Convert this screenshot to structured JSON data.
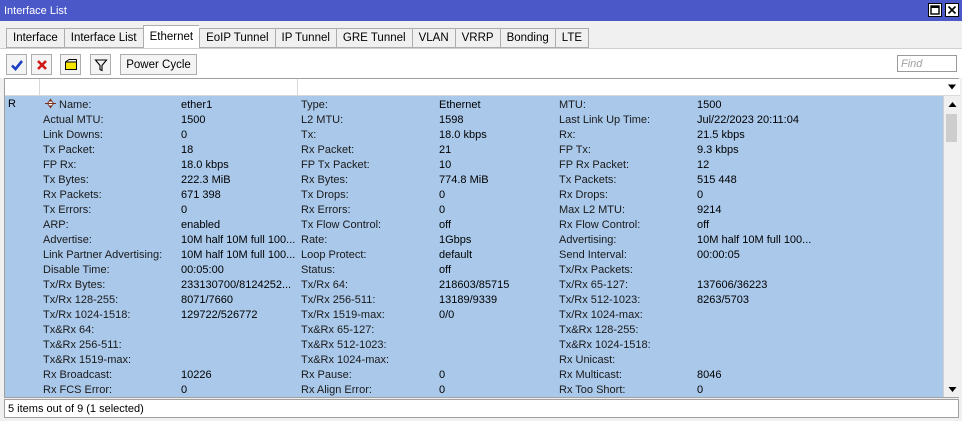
{
  "window": {
    "title": "Interface List"
  },
  "tabs": [
    {
      "label": "Interface",
      "active": false
    },
    {
      "label": "Interface List",
      "active": false
    },
    {
      "label": "Ethernet",
      "active": true
    },
    {
      "label": "EoIP Tunnel",
      "active": false
    },
    {
      "label": "IP Tunnel",
      "active": false
    },
    {
      "label": "GRE Tunnel",
      "active": false
    },
    {
      "label": "VLAN",
      "active": false
    },
    {
      "label": "VRRP",
      "active": false
    },
    {
      "label": "Bonding",
      "active": false
    },
    {
      "label": "LTE",
      "active": false
    }
  ],
  "toolbar": {
    "power_cycle_label": "Power Cycle",
    "find_placeholder": "Find"
  },
  "row": {
    "flag": "R",
    "columns": [
      [
        {
          "label": "Name:",
          "value": "ether1"
        },
        {
          "label": "Actual MTU:",
          "value": "1500"
        },
        {
          "label": "Link Downs:",
          "value": "0"
        },
        {
          "label": "Tx Packet:",
          "value": "18"
        },
        {
          "label": "FP Rx:",
          "value": "18.0 kbps"
        },
        {
          "label": "Tx Bytes:",
          "value": "222.3 MiB"
        },
        {
          "label": "Rx Packets:",
          "value": "671 398"
        },
        {
          "label": "Tx Errors:",
          "value": "0"
        },
        {
          "label": "ARP:",
          "value": "enabled"
        },
        {
          "label": "Advertise:",
          "value": "10M half 10M full 100..."
        },
        {
          "label": "Link Partner Advertising:",
          "value": "10M half 10M full 100..."
        },
        {
          "label": "Disable Time:",
          "value": "00:05:00"
        },
        {
          "label": "Tx/Rx Bytes:",
          "value": "233130700/8124252..."
        },
        {
          "label": "Tx/Rx 128-255:",
          "value": "8071/7660"
        },
        {
          "label": "Tx/Rx 1024-1518:",
          "value": "129722/526772"
        },
        {
          "label": "Tx&Rx 64:",
          "value": ""
        },
        {
          "label": "Tx&Rx 256-511:",
          "value": ""
        },
        {
          "label": "Tx&Rx 1519-max:",
          "value": ""
        },
        {
          "label": "Rx Broadcast:",
          "value": "10226"
        },
        {
          "label": "Rx FCS Error:",
          "value": "0"
        }
      ],
      [
        {
          "label": "Type:",
          "value": "Ethernet"
        },
        {
          "label": "L2 MTU:",
          "value": "1598"
        },
        {
          "label": "Tx:",
          "value": "18.0 kbps"
        },
        {
          "label": "Rx Packet:",
          "value": "21"
        },
        {
          "label": "FP Tx Packet:",
          "value": "10"
        },
        {
          "label": "Rx Bytes:",
          "value": "774.8 MiB"
        },
        {
          "label": "Tx Drops:",
          "value": "0"
        },
        {
          "label": "Rx Errors:",
          "value": "0"
        },
        {
          "label": "Tx Flow Control:",
          "value": "off"
        },
        {
          "label": "Rate:",
          "value": "1Gbps"
        },
        {
          "label": "Loop Protect:",
          "value": "default"
        },
        {
          "label": "Status:",
          "value": "off"
        },
        {
          "label": "Tx/Rx 64:",
          "value": "218603/85715"
        },
        {
          "label": "Tx/Rx 256-511:",
          "value": "13189/9339"
        },
        {
          "label": "Tx/Rx 1519-max:",
          "value": "0/0"
        },
        {
          "label": "Tx&Rx 65-127:",
          "value": ""
        },
        {
          "label": "Tx&Rx 512-1023:",
          "value": ""
        },
        {
          "label": "Tx&Rx 1024-max:",
          "value": ""
        },
        {
          "label": "Rx Pause:",
          "value": "0"
        },
        {
          "label": "Rx Align Error:",
          "value": "0"
        }
      ],
      [
        {
          "label": "MTU:",
          "value": "1500"
        },
        {
          "label": "Last Link Up Time:",
          "value": "Jul/22/2023 20:11:04"
        },
        {
          "label": "Rx:",
          "value": "21.5 kbps"
        },
        {
          "label": "FP Tx:",
          "value": "9.3 kbps"
        },
        {
          "label": "FP Rx Packet:",
          "value": "12"
        },
        {
          "label": "Tx Packets:",
          "value": "515 448"
        },
        {
          "label": "Rx Drops:",
          "value": "0"
        },
        {
          "label": "Max L2 MTU:",
          "value": "9214"
        },
        {
          "label": "Rx Flow Control:",
          "value": "off"
        },
        {
          "label": "Advertising:",
          "value": "10M half 10M full 100..."
        },
        {
          "label": "Send Interval:",
          "value": "00:00:05"
        },
        {
          "label": "Tx/Rx Packets:",
          "value": ""
        },
        {
          "label": "Tx/Rx 65-127:",
          "value": "137606/36223"
        },
        {
          "label": "Tx/Rx 512-1023:",
          "value": "8263/5703"
        },
        {
          "label": "Tx/Rx 1024-max:",
          "value": ""
        },
        {
          "label": "Tx&Rx 128-255:",
          "value": ""
        },
        {
          "label": "Tx&Rx 1024-1518:",
          "value": ""
        },
        {
          "label": "Rx Unicast:",
          "value": ""
        },
        {
          "label": "Rx Multicast:",
          "value": "8046"
        },
        {
          "label": "Rx Too Short:",
          "value": "0"
        }
      ]
    ]
  },
  "status": {
    "text": "5 items out of 9 (1 selected)"
  },
  "colors": {
    "titlebar": "#4a58c8",
    "selected_row": "#a9c8ea",
    "check_icon": "#1d3fc4",
    "remove_icon": "#d01818",
    "comment_icon": "#f4e400"
  }
}
